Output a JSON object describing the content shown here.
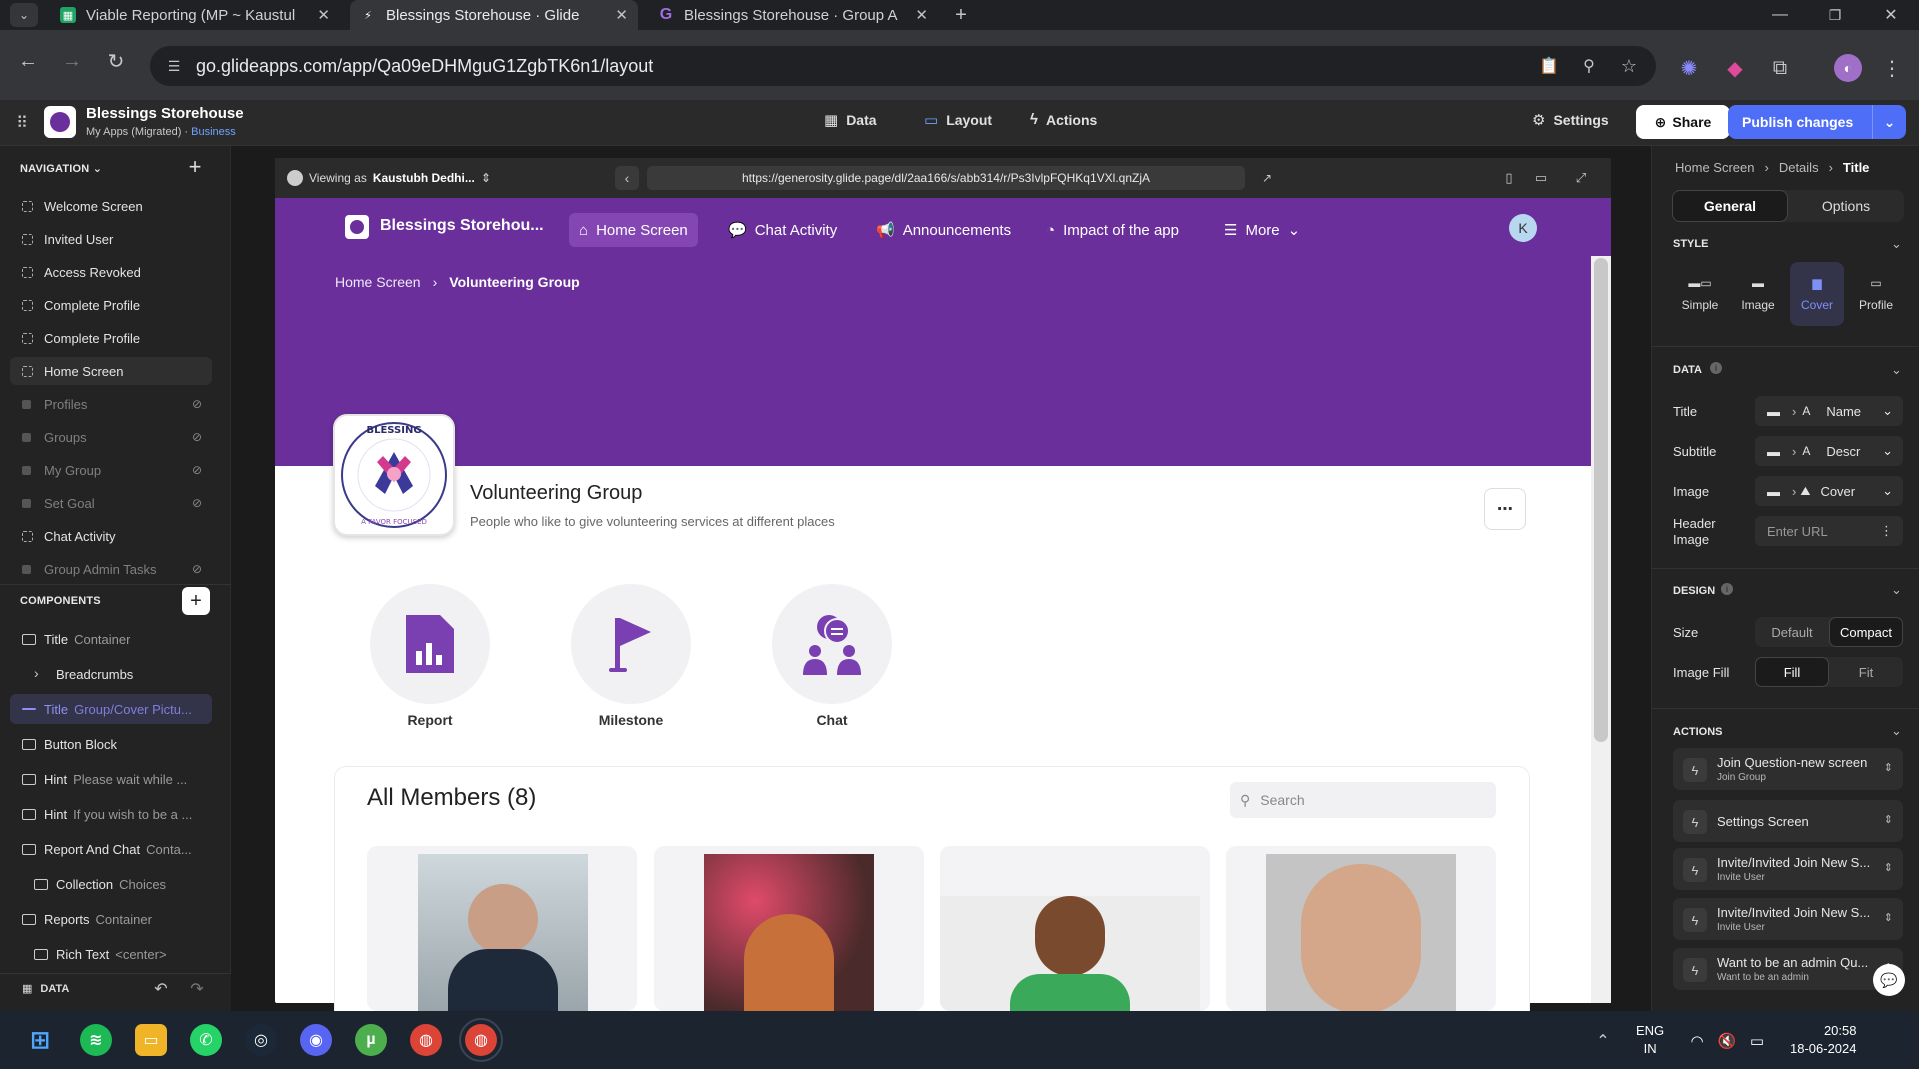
{
  "browser": {
    "tabs": [
      {
        "title": "Viable Reporting (MP ~ Kaustul",
        "active": false
      },
      {
        "title": "Blessings Storehouse · Glide",
        "active": true
      },
      {
        "title": "Blessings Storehouse · Group A",
        "active": false
      }
    ],
    "url": "go.glideapps.com/app/Qa09eDHMguG1ZgbTK6n1/layout"
  },
  "app": {
    "name": "Blessings Storehouse",
    "sub": "My Apps (Migrated)",
    "plan": "Business",
    "topnav": [
      "Data",
      "Layout",
      "Actions"
    ],
    "settings": "Settings",
    "share": "Share",
    "publish": "Publish changes"
  },
  "left": {
    "nav_title": "NAVIGATION",
    "screens": [
      {
        "label": "Welcome Screen",
        "hidden": false
      },
      {
        "label": "Invited User",
        "hidden": false
      },
      {
        "label": "Access Revoked",
        "hidden": false
      },
      {
        "label": "Complete Profile",
        "hidden": false
      },
      {
        "label": "Complete Profile",
        "hidden": false
      },
      {
        "label": "Home Screen",
        "hidden": false
      },
      {
        "label": "Profiles",
        "hidden": true
      },
      {
        "label": "Groups",
        "hidden": true
      },
      {
        "label": "My Group",
        "hidden": true
      },
      {
        "label": "Set Goal",
        "hidden": true
      },
      {
        "label": "Chat Activity",
        "hidden": false
      },
      {
        "label": "Group Admin Tasks",
        "hidden": true
      }
    ],
    "comp_title": "COMPONENTS",
    "components": [
      {
        "label": "Title",
        "sub": "Container"
      },
      {
        "label": "Breadcrumbs",
        "sub": ""
      },
      {
        "label": "Title",
        "sub": "Group/Cover Pictu..."
      },
      {
        "label": "Button Block",
        "sub": ""
      },
      {
        "label": "Hint",
        "sub": "Please wait while ..."
      },
      {
        "label": "Hint",
        "sub": "If you wish to be a ..."
      },
      {
        "label": "Report And Chat",
        "sub": "Conta..."
      },
      {
        "label": "Collection",
        "sub": "Choices"
      },
      {
        "label": "Reports",
        "sub": "Container"
      },
      {
        "label": "Rich Text",
        "sub": "<center>"
      }
    ],
    "data_label": "DATA"
  },
  "preview": {
    "viewing_as": "Viewing as",
    "viewer": "Kaustubh Dedhi...",
    "url": "https://generosity.glide.page/dl/2aa166/s/abb314/r/Ps3IvlpFQHKq1VXl.qnZjA",
    "app_title": "Blessings Storehou...",
    "nav": [
      "Home Screen",
      "Chat Activity",
      "Announcements",
      "Impact of the app",
      "More"
    ],
    "avatar": "K",
    "breadcrumb": [
      "Home Screen",
      "Volunteering Group"
    ],
    "group_title": "Volunteering Group",
    "group_desc": "People who like to give volunteering services at different places",
    "buttons": [
      "Report",
      "Milestone",
      "Chat"
    ],
    "members_title": "All Members (8)",
    "search_placeholder": "Search",
    "logo_text": "THE BLESSINGHOOD",
    "logo_sub": "A FAVOR FOCUSED COMMUNITY"
  },
  "right": {
    "crumbs": [
      "Home Screen",
      "Details",
      "Title"
    ],
    "tabs": [
      "General",
      "Options"
    ],
    "style_title": "STYLE",
    "styles": [
      "Simple",
      "Image",
      "Cover",
      "Profile"
    ],
    "selected_style": "Cover",
    "data_title": "DATA",
    "rows": [
      {
        "label": "Title",
        "value": "Name",
        "type": "A"
      },
      {
        "label": "Subtitle",
        "value": "Descr",
        "type": "A"
      },
      {
        "label": "Image",
        "value": "Cover",
        "type": ""
      }
    ],
    "header_image_label": "Header Image",
    "header_image_placeholder": "Enter URL",
    "design_title": "DESIGN",
    "size_label": "Size",
    "size_options": [
      "Default",
      "Compact"
    ],
    "size_selected": "Compact",
    "fill_label": "Image Fill",
    "fill_options": [
      "Fill",
      "Fit"
    ],
    "fill_selected": "Fill",
    "actions_title": "ACTIONS",
    "actions": [
      {
        "title": "Join Question-new screen",
        "sub": "Join Group"
      },
      {
        "title": "Settings Screen",
        "sub": ""
      },
      {
        "title": "Invite/Invited Join New S...",
        "sub": "Invite User"
      },
      {
        "title": "Invite/Invited Join New S...",
        "sub": "Invite User"
      },
      {
        "title": "Want to be an admin Qu...",
        "sub": "Want to be an admin"
      }
    ]
  },
  "taskbar": {
    "lang1": "ENG",
    "lang2": "IN",
    "time": "20:58",
    "date": "18-06-2024"
  },
  "colors": {
    "brand_purple": "#6a2f9b",
    "publish_blue": "#4f6ef7",
    "accent": "#8446b2"
  }
}
